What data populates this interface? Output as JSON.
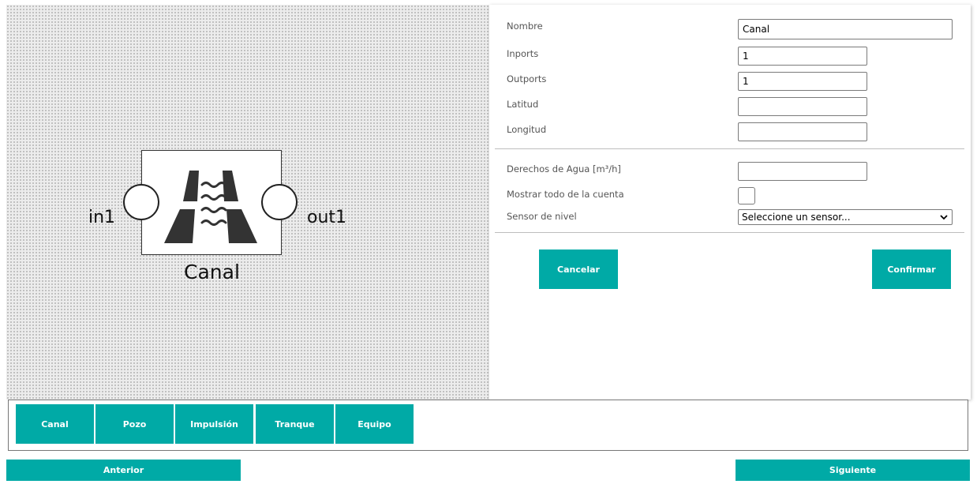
{
  "canvas": {
    "node": {
      "name": "Canal",
      "in_port_label": "in1",
      "out_port_label": "out1",
      "icon": "canal-icon"
    }
  },
  "form": {
    "fields": [
      {
        "label": "Nombre",
        "value": "Canal"
      },
      {
        "label": "Inports",
        "value": "1"
      },
      {
        "label": "Outports",
        "value": "1"
      },
      {
        "label": "Latitud",
        "value": ""
      },
      {
        "label": "Longitud",
        "value": ""
      }
    ],
    "water_rights": {
      "label": "Derechos de Agua [m³/h]",
      "value": ""
    },
    "show_all": {
      "label": "Mostrar todo de la cuenta",
      "checked": false
    },
    "sensor": {
      "label": "Sensor de nivel",
      "selected": "Seleccione un sensor..."
    },
    "cancel_label": "Cancelar",
    "confirm_label": "Confirmar"
  },
  "palette": {
    "items": [
      "Canal",
      "Pozo",
      "Impulsión",
      "Tranque",
      "Equipo"
    ]
  },
  "nav": {
    "prev_label": "Anterior",
    "next_label": "Siguiente"
  },
  "colors": {
    "accent": "#00aaa6",
    "icon_dark": "#333333"
  }
}
